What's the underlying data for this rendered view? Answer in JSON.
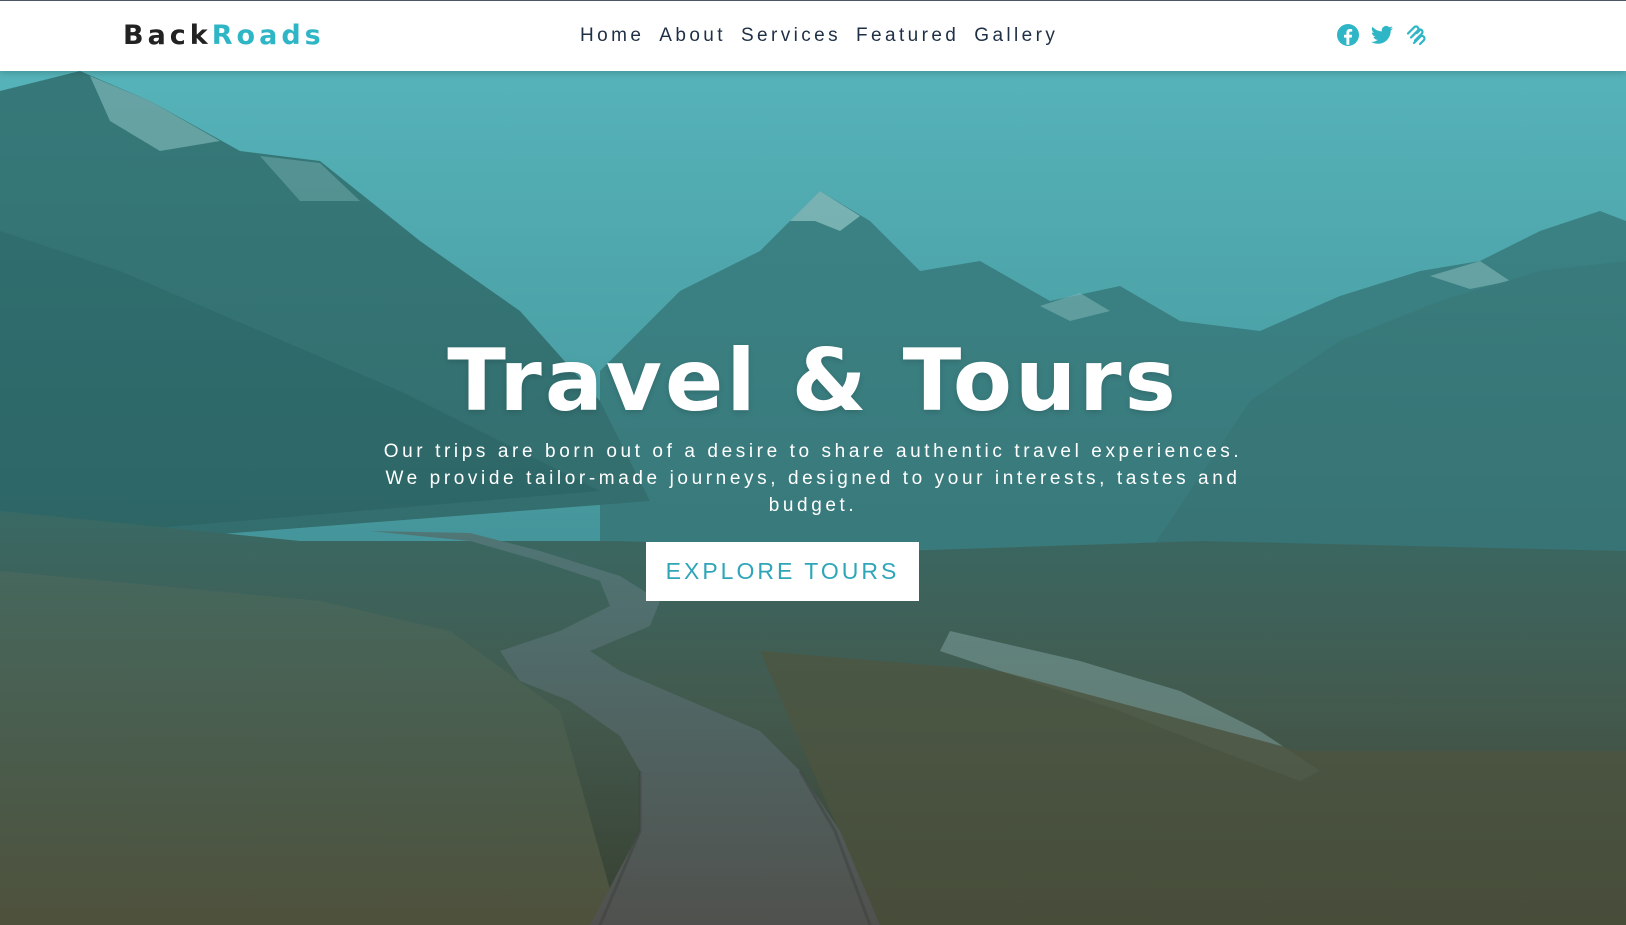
{
  "brand": {
    "part1": "Back",
    "part2": "Roads"
  },
  "nav": {
    "links": [
      "Home",
      "About",
      "Services",
      "Featured",
      "Gallery"
    ]
  },
  "social": {
    "icons": [
      "facebook-icon",
      "twitter-icon",
      "squarespace-icon"
    ],
    "color": "#2fb6c6"
  },
  "hero": {
    "title": "Travel & Tours",
    "text": "Our trips are born out of a desire to share authentic travel experiences. We provide tailor-made journeys, designed to your interests, tastes and budget.",
    "button": "EXPLORE TOURS"
  },
  "colors": {
    "accent": "#2fb6c6",
    "nav_text": "#1f2f45",
    "logo_dark": "#222222"
  }
}
